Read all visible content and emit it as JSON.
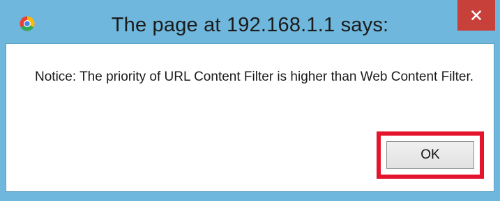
{
  "dialog": {
    "title": "The page at 192.168.1.1 says:",
    "app_icon": "chrome-icon",
    "close_icon": "close-icon",
    "message": "Notice: The priority of URL Content Filter is higher than Web Content Filter.",
    "ok_label": "OK"
  },
  "colors": {
    "frame": "#6fb7dc",
    "close_button": "#c8403a",
    "highlight": "#e3142b"
  }
}
